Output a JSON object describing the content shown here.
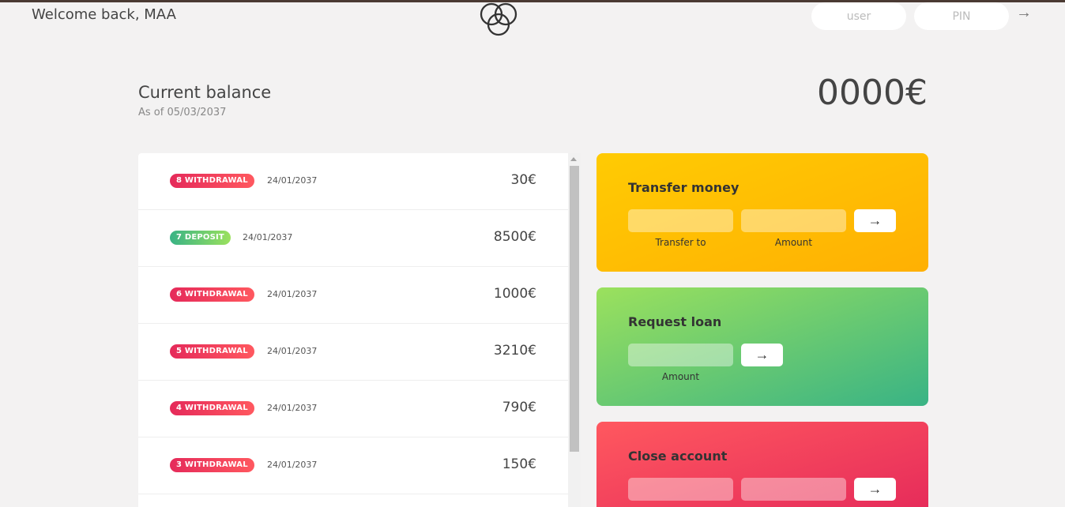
{
  "header": {
    "welcome": "Welcome back, MAA",
    "user_placeholder": "user",
    "pin_placeholder": "PIN",
    "login_arrow": "→"
  },
  "balance": {
    "label": "Current balance",
    "date_text": "As of 05/03/2037",
    "value": "0000€"
  },
  "movements": [
    {
      "badge": "8 withdrawal",
      "type": "withdrawal",
      "date": "24/01/2037",
      "value": "30€"
    },
    {
      "badge": "7 deposit",
      "type": "deposit",
      "date": "24/01/2037",
      "value": "8500€"
    },
    {
      "badge": "6 withdrawal",
      "type": "withdrawal",
      "date": "24/01/2037",
      "value": "1000€"
    },
    {
      "badge": "5 withdrawal",
      "type": "withdrawal",
      "date": "24/01/2037",
      "value": "3210€"
    },
    {
      "badge": "4 withdrawal",
      "type": "withdrawal",
      "date": "24/01/2037",
      "value": "790€"
    },
    {
      "badge": "3 withdrawal",
      "type": "withdrawal",
      "date": "24/01/2037",
      "value": "150€"
    }
  ],
  "operations": {
    "transfer": {
      "title": "Transfer money",
      "to_label": "Transfer to",
      "amount_label": "Amount",
      "button": "→"
    },
    "loan": {
      "title": "Request loan",
      "amount_label": "Amount",
      "button": "→"
    },
    "close": {
      "title": "Close account",
      "button": "→"
    }
  },
  "colors": {
    "withdrawal": "#e52a5a",
    "deposit": "#39b385",
    "transfer": "#ffb003",
    "loan": "#39b385",
    "close": "#ff585f"
  },
  "icons": {
    "logo": "bankist-logo-icon",
    "arrow": "arrow-right-icon"
  }
}
